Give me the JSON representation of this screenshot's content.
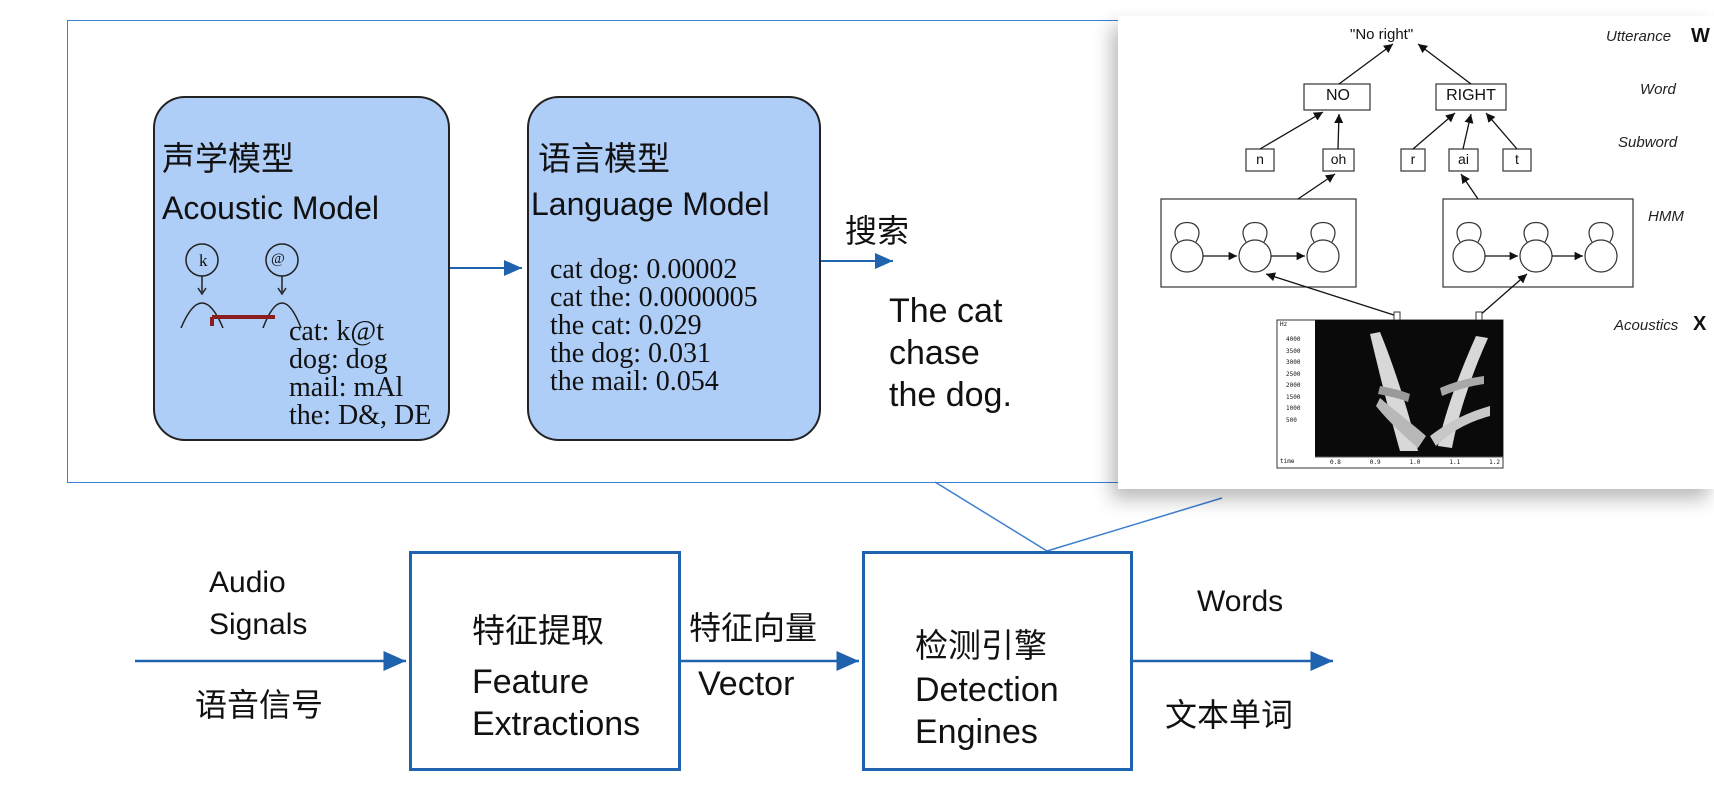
{
  "acoustic_model": {
    "title_zh": "声学模型",
    "title_en": "Acoustic Model",
    "phone_left": "k",
    "phone_right": "@",
    "entries": [
      "cat: k@t",
      "dog: dog",
      "mail: mAl",
      "the: D&, DE"
    ]
  },
  "language_model": {
    "title_zh": "语言模型",
    "title_en": "Language Model",
    "entries": [
      "cat dog: 0.00002",
      "cat the: 0.0000005",
      "the cat: 0.029",
      "the dog: 0.031",
      "the mail: 0.054"
    ]
  },
  "search": {
    "label_zh": "搜索",
    "result_lines": [
      "The cat",
      "chase",
      "the dog."
    ]
  },
  "pipeline": {
    "input": {
      "label_en_1": "Audio",
      "label_en_2": "Signals",
      "label_zh": "语音信号"
    },
    "feature": {
      "label_zh": "特征提取",
      "label_en_1": "Feature",
      "label_en_2": "Extractions"
    },
    "vector": {
      "label_zh": "特征向量",
      "label_en": "Vector"
    },
    "engine": {
      "label_zh": "检测引擎",
      "label_en_1": "Detection",
      "label_en_2": "Engines"
    },
    "output": {
      "label_en": "Words",
      "label_zh": "文本单词"
    }
  },
  "hmm_figure": {
    "utterance_text": "\"No right\"",
    "words": [
      "NO",
      "RIGHT"
    ],
    "subwords": [
      "n",
      "oh",
      "r",
      "ai",
      "t"
    ],
    "level_labels": [
      "Utterance",
      "Word",
      "Subword",
      "HMM",
      "Acoustics"
    ],
    "level_symbols": {
      "utterance": "W",
      "acoustics": "X"
    },
    "spectrogram_y_ticks": [
      "4000",
      "3500",
      "3000",
      "2500",
      "2000",
      "1500",
      "1000",
      "500"
    ],
    "spectrogram_x_label": "time",
    "spectrogram_x_ticks": [
      "0.8",
      "0.9",
      "1.0",
      "1.1",
      "1.2"
    ],
    "spectrogram_hz": "Hz"
  },
  "colors": {
    "flow_blue": "#1f62ad",
    "model_fill": "#aecdf7",
    "marker_red": "#8b1d1d"
  }
}
